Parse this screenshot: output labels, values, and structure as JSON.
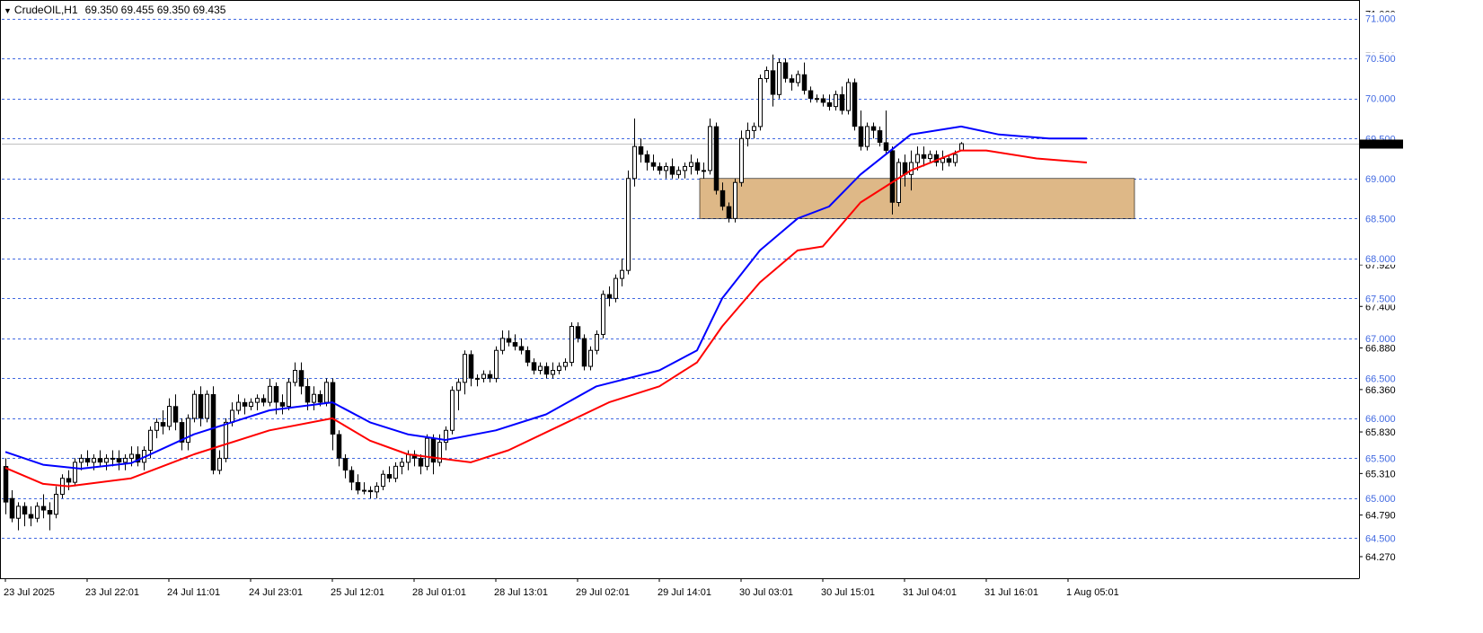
{
  "header": {
    "symbol": "CrudeOIL,H1",
    "ohlc": "69.350 69.455 69.350 69.435"
  },
  "chart_data": {
    "type": "candlestick",
    "symbol": "CrudeOIL",
    "timeframe": "H1",
    "ylim": [
      64.0,
      71.21
    ],
    "grid": "dashed horizontal",
    "current_price": 69.435,
    "y_level_labels": [
      "71.000",
      "70.500",
      "70.000",
      "69.500",
      "69.000",
      "68.500",
      "68.000",
      "67.500",
      "67.000",
      "66.500",
      "66.000",
      "65.500",
      "65.000",
      "64.500"
    ],
    "y_level_values": [
      71.0,
      70.5,
      70.0,
      69.5,
      69.0,
      68.5,
      68.0,
      67.5,
      67.0,
      66.5,
      66.0,
      65.5,
      65.0,
      64.5
    ],
    "y_tick_labels": [
      "71.060",
      "70.540",
      "67.920",
      "67.400",
      "66.880",
      "66.360",
      "65.830",
      "65.310",
      "64.790",
      "64.270"
    ],
    "y_tick_values": [
      71.06,
      70.54,
      67.92,
      67.4,
      66.88,
      66.36,
      65.83,
      65.31,
      64.79,
      64.27
    ],
    "x_tick_labels": [
      "23 Jul 2025",
      "23 Jul 22:01",
      "24 Jul 11:01",
      "24 Jul 23:01",
      "25 Jul 12:01",
      "28 Jul 01:01",
      "28 Jul 13:01",
      "29 Jul 02:01",
      "29 Jul 14:01",
      "30 Jul 03:01",
      "30 Jul 15:01",
      "31 Jul 04:01",
      "31 Jul 16:01",
      "1 Aug 05:01"
    ],
    "x_tick_bars": [
      0,
      13,
      26,
      39,
      52,
      65,
      78,
      91,
      104,
      117,
      130,
      143,
      156,
      169
    ],
    "zone": {
      "from_bar": 111,
      "to_bar": 179,
      "low": 68.5,
      "high": 69.0,
      "color": "#DEB887"
    },
    "series": [
      {
        "type": "ma",
        "color": "#0000FF",
        "points": [
          [
            0,
            65.58
          ],
          [
            6,
            65.42
          ],
          [
            12,
            65.37
          ],
          [
            20,
            65.44
          ],
          [
            30,
            65.8
          ],
          [
            42,
            66.1
          ],
          [
            52,
            66.2
          ],
          [
            58,
            65.95
          ],
          [
            64,
            65.8
          ],
          [
            70,
            65.73
          ],
          [
            78,
            65.85
          ],
          [
            86,
            66.05
          ],
          [
            94,
            66.4
          ],
          [
            104,
            66.6
          ],
          [
            110,
            66.85
          ],
          [
            114,
            67.5
          ],
          [
            120,
            68.1
          ],
          [
            126,
            68.5
          ],
          [
            131,
            68.65
          ],
          [
            136,
            69.05
          ],
          [
            144,
            69.55
          ],
          [
            152,
            69.65
          ],
          [
            158,
            69.55
          ],
          [
            166,
            69.5
          ],
          [
            172,
            69.5
          ]
        ]
      },
      {
        "type": "ma",
        "color": "#FF0000",
        "points": [
          [
            0,
            65.38
          ],
          [
            6,
            65.18
          ],
          [
            10,
            65.15
          ],
          [
            20,
            65.25
          ],
          [
            30,
            65.55
          ],
          [
            42,
            65.85
          ],
          [
            52,
            66.0
          ],
          [
            58,
            65.72
          ],
          [
            64,
            65.55
          ],
          [
            74,
            65.45
          ],
          [
            80,
            65.6
          ],
          [
            88,
            65.9
          ],
          [
            96,
            66.2
          ],
          [
            104,
            66.4
          ],
          [
            110,
            66.7
          ],
          [
            114,
            67.15
          ],
          [
            120,
            67.7
          ],
          [
            126,
            68.1
          ],
          [
            130,
            68.15
          ],
          [
            136,
            68.7
          ],
          [
            144,
            69.1
          ],
          [
            152,
            69.35
          ],
          [
            156,
            69.35
          ],
          [
            164,
            69.25
          ],
          [
            172,
            69.2
          ]
        ]
      }
    ],
    "candles": [
      [
        65.4,
        65.5,
        64.8,
        64.95
      ],
      [
        65.0,
        65.1,
        64.7,
        64.75
      ],
      [
        64.75,
        64.95,
        64.6,
        64.9
      ],
      [
        64.9,
        64.95,
        64.65,
        64.8
      ],
      [
        64.8,
        64.9,
        64.65,
        64.75
      ],
      [
        64.75,
        64.95,
        64.7,
        64.9
      ],
      [
        64.9,
        65.05,
        64.75,
        64.85
      ],
      [
        64.85,
        64.95,
        64.6,
        64.8
      ],
      [
        64.8,
        65.15,
        64.75,
        65.05
      ],
      [
        65.05,
        65.3,
        65.0,
        65.25
      ],
      [
        65.25,
        65.35,
        65.1,
        65.2
      ],
      [
        65.2,
        65.5,
        65.15,
        65.45
      ],
      [
        65.45,
        65.55,
        65.35,
        65.5
      ],
      [
        65.5,
        65.6,
        65.4,
        65.45
      ],
      [
        65.45,
        65.55,
        65.35,
        65.5
      ],
      [
        65.5,
        65.6,
        65.4,
        65.45
      ],
      [
        65.45,
        65.55,
        65.35,
        65.5
      ],
      [
        65.5,
        65.6,
        65.4,
        65.5
      ],
      [
        65.5,
        65.6,
        65.35,
        65.45
      ],
      [
        65.45,
        65.55,
        65.35,
        65.5
      ],
      [
        65.5,
        65.65,
        65.4,
        65.55
      ],
      [
        65.55,
        65.65,
        65.4,
        65.45
      ],
      [
        65.45,
        65.65,
        65.35,
        65.6
      ],
      [
        65.6,
        65.9,
        65.5,
        65.85
      ],
      [
        65.85,
        66.0,
        65.75,
        65.95
      ],
      [
        65.95,
        66.1,
        65.8,
        65.9
      ],
      [
        65.9,
        66.25,
        65.85,
        66.15
      ],
      [
        66.15,
        66.3,
        65.85,
        65.95
      ],
      [
        65.95,
        66.0,
        65.6,
        65.7
      ],
      [
        65.7,
        66.05,
        65.6,
        66.0
      ],
      [
        66.0,
        66.35,
        65.95,
        66.3
      ],
      [
        66.3,
        66.4,
        65.9,
        66.0
      ],
      [
        66.0,
        66.35,
        65.95,
        66.3
      ],
      [
        66.3,
        66.4,
        65.3,
        65.35
      ],
      [
        65.35,
        65.6,
        65.3,
        65.5
      ],
      [
        65.5,
        66.0,
        65.45,
        65.95
      ],
      [
        65.95,
        66.2,
        65.9,
        66.1
      ],
      [
        66.1,
        66.3,
        66.05,
        66.2
      ],
      [
        66.2,
        66.25,
        66.05,
        66.15
      ],
      [
        66.15,
        66.25,
        66.1,
        66.2
      ],
      [
        66.2,
        66.3,
        66.1,
        66.25
      ],
      [
        66.25,
        66.3,
        66.15,
        66.2
      ],
      [
        66.2,
        66.5,
        66.15,
        66.4
      ],
      [
        66.4,
        66.45,
        66.05,
        66.2
      ],
      [
        66.2,
        66.3,
        66.05,
        66.15
      ],
      [
        66.15,
        66.5,
        66.1,
        66.45
      ],
      [
        66.45,
        66.7,
        66.4,
        66.6
      ],
      [
        66.6,
        66.7,
        66.3,
        66.4
      ],
      [
        66.4,
        66.5,
        66.1,
        66.2
      ],
      [
        66.2,
        66.4,
        66.1,
        66.3
      ],
      [
        66.3,
        66.35,
        66.15,
        66.2
      ],
      [
        66.2,
        66.5,
        66.15,
        66.45
      ],
      [
        66.45,
        66.5,
        65.6,
        65.8
      ],
      [
        65.8,
        65.85,
        65.4,
        65.5
      ],
      [
        65.5,
        65.55,
        65.25,
        65.35
      ],
      [
        65.35,
        65.4,
        65.1,
        65.2
      ],
      [
        65.2,
        65.3,
        65.05,
        65.1
      ],
      [
        65.1,
        65.2,
        65.05,
        65.1
      ],
      [
        65.1,
        65.15,
        65.0,
        65.08
      ],
      [
        65.08,
        65.2,
        65.0,
        65.15
      ],
      [
        65.15,
        65.35,
        65.1,
        65.3
      ],
      [
        65.3,
        65.4,
        65.2,
        65.25
      ],
      [
        65.25,
        65.45,
        65.2,
        65.4
      ],
      [
        65.4,
        65.5,
        65.3,
        65.45
      ],
      [
        65.45,
        65.6,
        65.35,
        65.55
      ],
      [
        65.55,
        65.6,
        65.4,
        65.5
      ],
      [
        65.5,
        65.55,
        65.3,
        65.4
      ],
      [
        65.4,
        65.8,
        65.35,
        65.75
      ],
      [
        65.75,
        65.8,
        65.3,
        65.45
      ],
      [
        65.45,
        65.8,
        65.4,
        65.7
      ],
      [
        65.7,
        65.9,
        65.6,
        65.85
      ],
      [
        65.85,
        66.4,
        65.8,
        66.35
      ],
      [
        66.35,
        66.5,
        66.1,
        66.45
      ],
      [
        66.45,
        66.85,
        66.3,
        66.8
      ],
      [
        66.8,
        66.85,
        66.4,
        66.5
      ],
      [
        66.5,
        66.55,
        66.4,
        66.5
      ],
      [
        66.5,
        66.6,
        66.45,
        66.55
      ],
      [
        66.55,
        66.6,
        66.45,
        66.5
      ],
      [
        66.5,
        66.9,
        66.45,
        66.85
      ],
      [
        66.85,
        67.1,
        66.8,
        67.0
      ],
      [
        67.0,
        67.1,
        66.9,
        66.95
      ],
      [
        66.95,
        67.05,
        66.85,
        66.9
      ],
      [
        66.9,
        67.0,
        66.8,
        66.85
      ],
      [
        66.85,
        66.9,
        66.65,
        66.7
      ],
      [
        66.7,
        66.75,
        66.55,
        66.6
      ],
      [
        66.6,
        66.7,
        66.55,
        66.65
      ],
      [
        66.65,
        66.7,
        66.5,
        66.55
      ],
      [
        66.55,
        66.7,
        66.5,
        66.6
      ],
      [
        66.6,
        66.7,
        66.55,
        66.65
      ],
      [
        66.65,
        66.75,
        66.6,
        66.7
      ],
      [
        66.7,
        67.2,
        66.65,
        67.15
      ],
      [
        67.15,
        67.2,
        66.95,
        67.0
      ],
      [
        67.0,
        67.05,
        66.6,
        66.65
      ],
      [
        66.65,
        66.9,
        66.6,
        66.85
      ],
      [
        66.85,
        67.1,
        66.8,
        67.05
      ],
      [
        67.05,
        67.6,
        67.0,
        67.55
      ],
      [
        67.55,
        67.65,
        67.4,
        67.5
      ],
      [
        67.5,
        67.8,
        67.45,
        67.75
      ],
      [
        67.75,
        68.0,
        67.65,
        67.85
      ],
      [
        67.85,
        69.1,
        67.8,
        69.0
      ],
      [
        69.0,
        69.75,
        68.9,
        69.4
      ],
      [
        69.4,
        69.5,
        69.2,
        69.3
      ],
      [
        69.3,
        69.35,
        69.1,
        69.2
      ],
      [
        69.2,
        69.3,
        69.1,
        69.15
      ],
      [
        69.15,
        69.2,
        69.05,
        69.1
      ],
      [
        69.1,
        69.2,
        69.0,
        69.15
      ],
      [
        69.15,
        69.25,
        69.0,
        69.05
      ],
      [
        69.05,
        69.15,
        69.0,
        69.1
      ],
      [
        69.1,
        69.2,
        69.0,
        69.15
      ],
      [
        69.15,
        69.3,
        69.05,
        69.2
      ],
      [
        69.2,
        69.25,
        69.05,
        69.1
      ],
      [
        69.1,
        69.2,
        69.0,
        69.1
      ],
      [
        69.1,
        69.75,
        69.05,
        69.65
      ],
      [
        69.65,
        69.7,
        68.8,
        68.85
      ],
      [
        68.85,
        68.95,
        68.6,
        68.65
      ],
      [
        68.65,
        68.7,
        68.45,
        68.5
      ],
      [
        68.5,
        69.0,
        68.45,
        68.95
      ],
      [
        68.95,
        69.6,
        68.9,
        69.5
      ],
      [
        69.5,
        69.7,
        69.4,
        69.6
      ],
      [
        69.6,
        69.7,
        69.5,
        69.65
      ],
      [
        69.65,
        70.3,
        69.6,
        70.25
      ],
      [
        70.25,
        70.4,
        70.2,
        70.35
      ],
      [
        70.35,
        70.55,
        69.9,
        70.05
      ],
      [
        70.05,
        70.5,
        70.0,
        70.45
      ],
      [
        70.45,
        70.5,
        70.2,
        70.25
      ],
      [
        70.25,
        70.3,
        70.1,
        70.2
      ],
      [
        70.2,
        70.35,
        70.15,
        70.3
      ],
      [
        70.3,
        70.45,
        70.05,
        70.1
      ],
      [
        70.1,
        70.15,
        69.95,
        70.0
      ],
      [
        70.0,
        70.05,
        69.95,
        70.0
      ],
      [
        70.0,
        70.05,
        69.9,
        69.95
      ],
      [
        69.95,
        70.05,
        69.85,
        69.9
      ],
      [
        69.9,
        70.1,
        69.85,
        70.05
      ],
      [
        70.05,
        70.15,
        69.8,
        69.85
      ],
      [
        69.85,
        70.25,
        69.8,
        70.2
      ],
      [
        70.2,
        70.25,
        69.6,
        69.65
      ],
      [
        69.65,
        69.85,
        69.35,
        69.4
      ],
      [
        69.4,
        69.7,
        69.35,
        69.65
      ],
      [
        69.65,
        69.7,
        69.5,
        69.6
      ],
      [
        69.6,
        69.65,
        69.4,
        69.45
      ],
      [
        69.45,
        69.85,
        69.3,
        69.35
      ],
      [
        69.35,
        69.4,
        68.55,
        68.7
      ],
      [
        68.7,
        69.25,
        68.65,
        69.2
      ],
      [
        69.2,
        69.3,
        68.9,
        69.05
      ],
      [
        69.05,
        69.35,
        68.85,
        69.2
      ],
      [
        69.2,
        69.4,
        69.1,
        69.3
      ],
      [
        69.3,
        69.4,
        69.15,
        69.25
      ],
      [
        69.25,
        69.35,
        69.2,
        69.3
      ],
      [
        69.3,
        69.35,
        69.15,
        69.2
      ],
      [
        69.2,
        69.35,
        69.1,
        69.25
      ],
      [
        69.25,
        69.3,
        69.15,
        69.2
      ],
      [
        69.2,
        69.35,
        69.15,
        69.3
      ],
      [
        69.35,
        69.455,
        69.35,
        69.435
      ]
    ]
  }
}
